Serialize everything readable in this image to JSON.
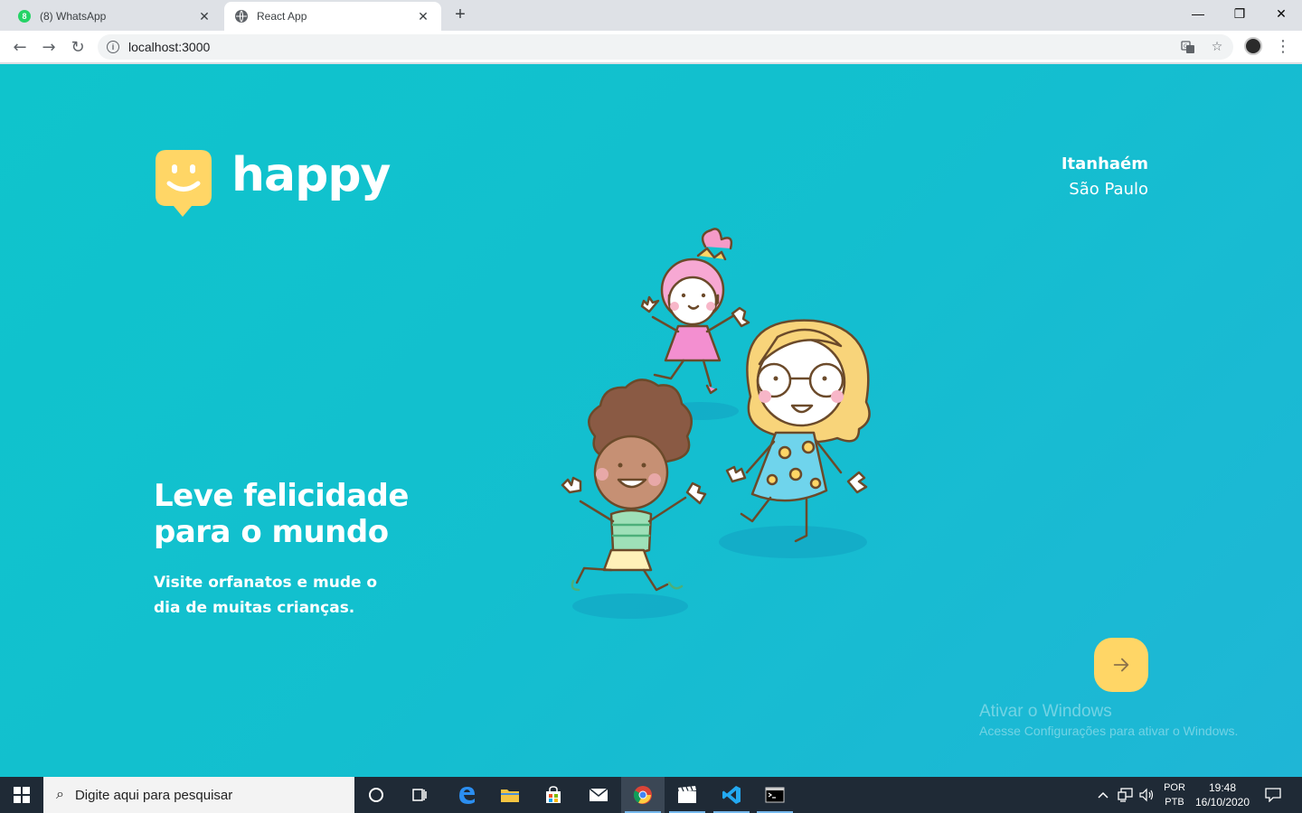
{
  "browser": {
    "tabs": [
      {
        "title": "(8) WhatsApp",
        "badge": "8",
        "active": false
      },
      {
        "title": "React App",
        "active": true
      }
    ],
    "new_tab_label": "+",
    "window_controls": {
      "minimize": "—",
      "restore": "❐",
      "close": "✕"
    },
    "nav": {
      "back": "←",
      "forward": "→",
      "reload": "↻"
    },
    "url": "localhost:3000",
    "info_glyph": "i",
    "icons": [
      "translate-icon",
      "star-icon",
      "profile-avatar",
      "menu-kebab-icon"
    ]
  },
  "page": {
    "brand": "happy",
    "location": {
      "city": "Itanhaém",
      "state": "São Paulo"
    },
    "headline": "Leve felicidade para o mundo",
    "subtitle": "Visite orfanatos e mude o dia de muitas crianças.",
    "enter_button_icon": "arrow-right-icon",
    "colors": {
      "background_start": "#0fc4cc",
      "background_end": "#1fb6d6",
      "accent_yellow": "#ffd666",
      "text": "#ffffff"
    },
    "windows_activation": {
      "title": "Ativar o Windows",
      "message": "Acesse Configurações para ativar o Windows."
    }
  },
  "taskbar": {
    "search_placeholder": "Digite aqui para pesquisar",
    "apps": [
      "cortana-icon",
      "task-view-icon",
      "edge-icon",
      "file-explorer-icon",
      "store-icon",
      "mail-icon",
      "chrome-icon",
      "video-editor-icon",
      "vscode-icon",
      "terminal-icon"
    ],
    "tray": {
      "lang_line1": "POR",
      "lang_line2": "PTB",
      "time": "19:48",
      "date": "16/10/2020"
    }
  }
}
